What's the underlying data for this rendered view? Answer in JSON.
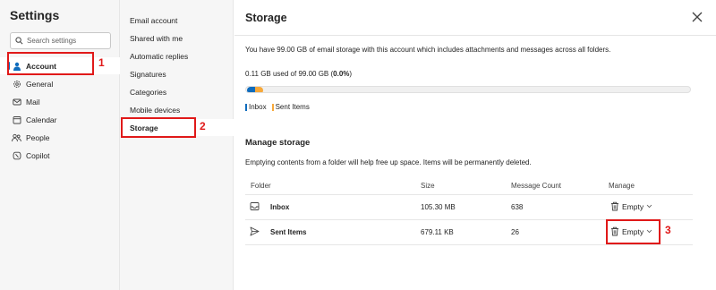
{
  "left": {
    "title": "Settings",
    "search_placeholder": "Search settings",
    "items": [
      {
        "label": "Account",
        "icon": "person-icon"
      },
      {
        "label": "General",
        "icon": "gear-icon"
      },
      {
        "label": "Mail",
        "icon": "mail-icon"
      },
      {
        "label": "Calendar",
        "icon": "calendar-icon"
      },
      {
        "label": "People",
        "icon": "people-icon"
      },
      {
        "label": "Copilot",
        "icon": "copilot-icon"
      }
    ]
  },
  "middle": {
    "items": [
      "Email account",
      "Shared with me",
      "Automatic replies",
      "Signatures",
      "Categories",
      "Mobile devices",
      "Storage"
    ]
  },
  "main": {
    "title": "Storage",
    "description": "You have 99.00 GB of email storage with this account which includes attachments and messages across all folders.",
    "used_prefix": "0.11 GB used of 99.00 GB (",
    "used_percent": "0.0%",
    "used_suffix": ")",
    "usage": {
      "inbox_gb": 0.1053,
      "sent_gb": 0.00068
    },
    "legend": [
      {
        "label": "Inbox",
        "color": "#0f6cbd"
      },
      {
        "label": "Sent Items",
        "color": "#f7a93b"
      }
    ],
    "manage_title": "Manage storage",
    "manage_description": "Emptying contents from a folder will help free up space. Items will be permanently deleted.",
    "columns": {
      "folder": "Folder",
      "size": "Size",
      "count": "Message Count",
      "manage": "Manage"
    },
    "rows": [
      {
        "folder": "Inbox",
        "size": "105.30 MB",
        "count": "638",
        "action": "Empty",
        "icon": "inbox-icon"
      },
      {
        "folder": "Sent Items",
        "size": "679.11 KB",
        "count": "26",
        "action": "Empty",
        "icon": "send-icon"
      }
    ]
  },
  "annotations": [
    "1",
    "2",
    "3"
  ],
  "colors": {
    "accent": "#0f6cbd",
    "sent": "#f7a93b",
    "annotation": "#e01919"
  }
}
